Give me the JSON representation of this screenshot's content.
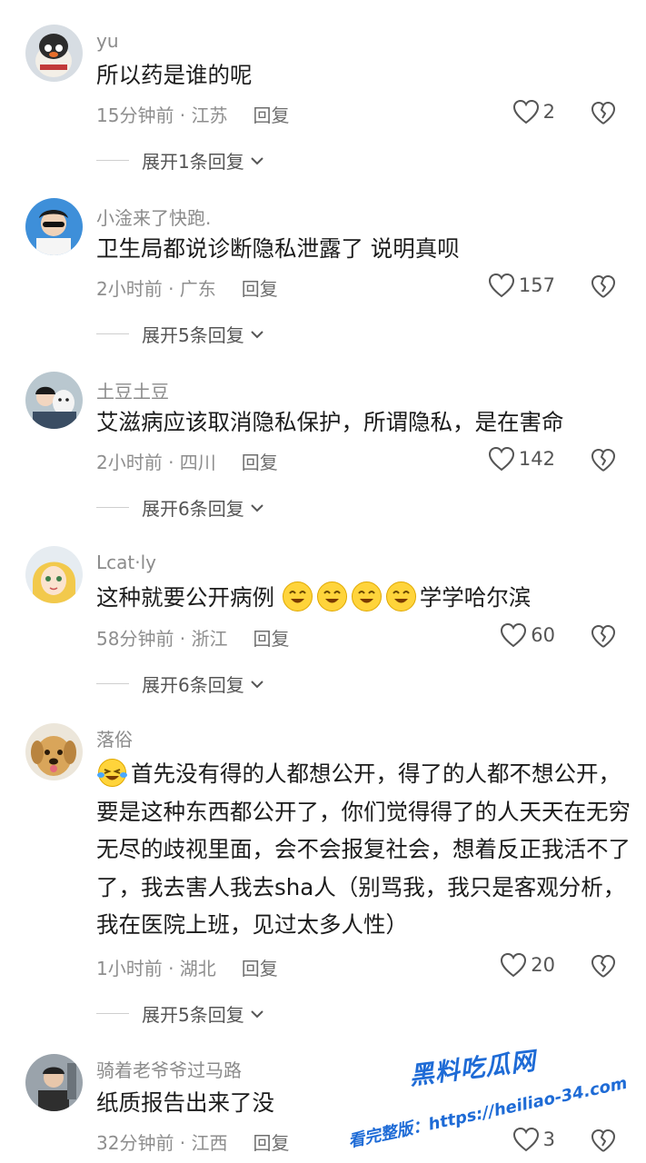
{
  "comments": [
    {
      "username": "yu",
      "text": "所以药是谁的呢",
      "time": "15分钟前 · 江苏",
      "reply_label": "回复",
      "likes": "2",
      "expand_label": "展开1条回复"
    },
    {
      "username": "小淦来了快跑.",
      "text": "卫生局都说诊断隐私泄露了 说明真呗",
      "time": "2小时前 · 广东",
      "reply_label": "回复",
      "likes": "157",
      "expand_label": "展开5条回复"
    },
    {
      "username": "土豆土豆",
      "text": "艾滋病应该取消隐私保护，所谓隐私，是在害命",
      "time": "2小时前 · 四川",
      "reply_label": "回复",
      "likes": "142",
      "expand_label": "展开6条回复"
    },
    {
      "username": "Lcat·ly",
      "text_before": "这种就要公开病例",
      "text_after": "学学哈尔滨",
      "time": "58分钟前 · 浙江",
      "reply_label": "回复",
      "likes": "60",
      "expand_label": "展开6条回复"
    },
    {
      "username": "落俗",
      "text": "首先没有得的人都想公开，得了的人都不想公开，要是这种东西都公开了，你们觉得得了的人天天在无穷无尽的歧视里面，会不会报复社会，想着反正我活不了了，我去害人我去sha人（别骂我，我只是客观分析，我在医院上班，见过太多人性）",
      "time": "1小时前 · 湖北",
      "reply_label": "回复",
      "likes": "20",
      "expand_label": "展开5条回复"
    },
    {
      "username": "骑着老爷爷过马路",
      "text": "纸质报告出来了没",
      "time": "32分钟前 · 江西",
      "reply_label": "回复",
      "likes": "3"
    }
  ],
  "watermark": {
    "title": "黑料吃瓜网",
    "url": "看完整版：https://heiliao-34.com"
  },
  "colors": {
    "username": "#8b8b8b",
    "meta": "#8e8e8e",
    "watermark": "#1e6bd6"
  }
}
